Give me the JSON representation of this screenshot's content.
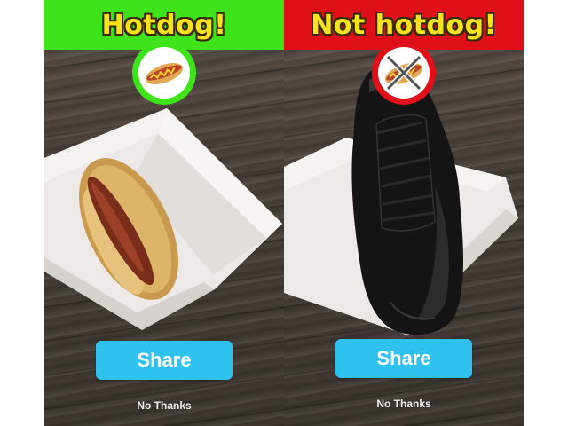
{
  "left_panel": {
    "title": "Hotdog!",
    "header_color": "#3fe31a",
    "badge_icon": "hotdog-icon",
    "share_label": "Share",
    "dismiss_label": "No Thanks"
  },
  "right_panel": {
    "title": "Not hotdog!",
    "header_color": "#e0101b",
    "badge_icon": "crossed-out-hotdog-icon",
    "share_label": "Share",
    "dismiss_label": "No Thanks"
  },
  "colors": {
    "title_text": "#f7e31d",
    "share_button": "#2fc2ee"
  }
}
